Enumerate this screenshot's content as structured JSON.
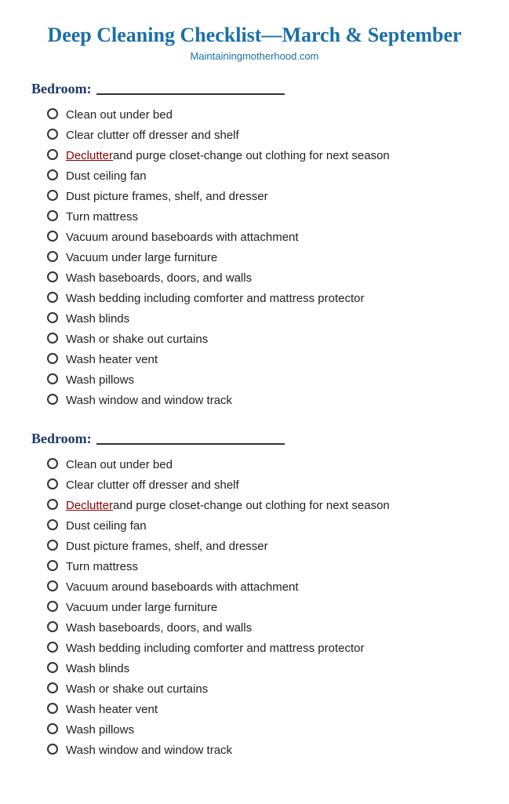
{
  "title": "Deep Cleaning Checklist—March & September",
  "subtitle": "Maintainingmotherhood.com",
  "sections": [
    {
      "id": "bedroom-1",
      "header_label": "Bedroom:",
      "items": [
        {
          "id": "b1-1",
          "text": "Clean out under bed",
          "special": false
        },
        {
          "id": "b1-2",
          "text": "Clear clutter off dresser and shelf",
          "special": false
        },
        {
          "id": "b1-3",
          "text_parts": [
            {
              "text": "Declutter",
              "style": "link"
            },
            {
              "text": " and purge closet-change out clothing for next season",
              "style": "normal"
            }
          ],
          "special": true
        },
        {
          "id": "b1-4",
          "text": "Dust ceiling fan",
          "special": false
        },
        {
          "id": "b1-5",
          "text": "Dust picture frames, shelf, and dresser",
          "special": false
        },
        {
          "id": "b1-6",
          "text": "Turn mattress",
          "special": false
        },
        {
          "id": "b1-7",
          "text": "Vacuum around baseboards with attachment",
          "special": false
        },
        {
          "id": "b1-8",
          "text": "Vacuum under large furniture",
          "special": false
        },
        {
          "id": "b1-9",
          "text": "Wash baseboards, doors, and walls",
          "special": false
        },
        {
          "id": "b1-10",
          "text": "Wash bedding including comforter and mattress protector",
          "special": false
        },
        {
          "id": "b1-11",
          "text": "Wash blinds",
          "special": false
        },
        {
          "id": "b1-12",
          "text": "Wash or shake out curtains",
          "special": false
        },
        {
          "id": "b1-13",
          "text": "Wash heater vent",
          "special": false
        },
        {
          "id": "b1-14",
          "text": "Wash pillows",
          "special": false
        },
        {
          "id": "b1-15",
          "text": "Wash window and window track",
          "special": false
        }
      ]
    },
    {
      "id": "bedroom-2",
      "header_label": "Bedroom:",
      "items": [
        {
          "id": "b2-1",
          "text": "Clean out under bed",
          "special": false
        },
        {
          "id": "b2-2",
          "text": "Clear clutter off dresser and shelf",
          "special": false
        },
        {
          "id": "b2-3",
          "text_parts": [
            {
              "text": "Declutter",
              "style": "link"
            },
            {
              "text": " and purge closet-change out clothing for next season",
              "style": "normal"
            }
          ],
          "special": true
        },
        {
          "id": "b2-4",
          "text": "Dust ceiling fan",
          "special": false
        },
        {
          "id": "b2-5",
          "text": "Dust picture frames, shelf, and dresser",
          "special": false
        },
        {
          "id": "b2-6",
          "text": "Turn mattress",
          "special": false
        },
        {
          "id": "b2-7",
          "text": "Vacuum around baseboards with attachment",
          "special": false
        },
        {
          "id": "b2-8",
          "text": "Vacuum under large furniture",
          "special": false
        },
        {
          "id": "b2-9",
          "text": "Wash baseboards, doors, and walls",
          "special": false
        },
        {
          "id": "b2-10",
          "text": "Wash bedding including comforter and mattress protector",
          "special": false
        },
        {
          "id": "b2-11",
          "text": "Wash blinds",
          "special": false
        },
        {
          "id": "b2-12",
          "text": "Wash or shake out curtains",
          "special": false
        },
        {
          "id": "b2-13",
          "text": "Wash heater vent",
          "special": false
        },
        {
          "id": "b2-14",
          "text": "Wash pillows",
          "special": false
        },
        {
          "id": "b2-15",
          "text": "Wash window and window track",
          "special": false
        }
      ]
    }
  ]
}
